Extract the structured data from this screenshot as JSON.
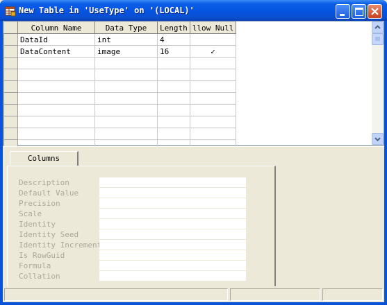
{
  "window": {
    "title": "New Table in 'UseType' on '(LOCAL)'"
  },
  "grid": {
    "columns": [
      "Column Name",
      "Data Type",
      "Length",
      "llow Null"
    ],
    "rows": [
      {
        "name": "DataId",
        "type": "int",
        "length": "4",
        "allow_null": ""
      },
      {
        "name": "DataContent",
        "type": "image",
        "length": "16",
        "allow_null": "✓"
      }
    ]
  },
  "lower": {
    "tab_label": "Columns",
    "properties": [
      {
        "label": "Description",
        "value": ""
      },
      {
        "label": "Default Value",
        "value": ""
      },
      {
        "label": "Precision",
        "value": ""
      },
      {
        "label": "Scale",
        "value": ""
      },
      {
        "label": "Identity",
        "value": ""
      },
      {
        "label": "Identity Seed",
        "value": ""
      },
      {
        "label": "Identity Increment",
        "value": ""
      },
      {
        "label": "Is RowGuid",
        "value": ""
      },
      {
        "label": "Formula",
        "value": ""
      },
      {
        "label": "Collation",
        "value": ""
      }
    ]
  },
  "icons": {
    "app": "table-designer-icon",
    "minimize": "minimize-icon",
    "maximize": "maximize-icon",
    "close": "close-icon",
    "scroll_up": "scroll-up-arrow-icon",
    "scroll_down": "scroll-down-arrow-icon"
  },
  "colors": {
    "titlebar": "#0554e0",
    "close_button": "#c9401d",
    "disabled_text": "#aca899",
    "panel_background": "#ece9d8"
  }
}
